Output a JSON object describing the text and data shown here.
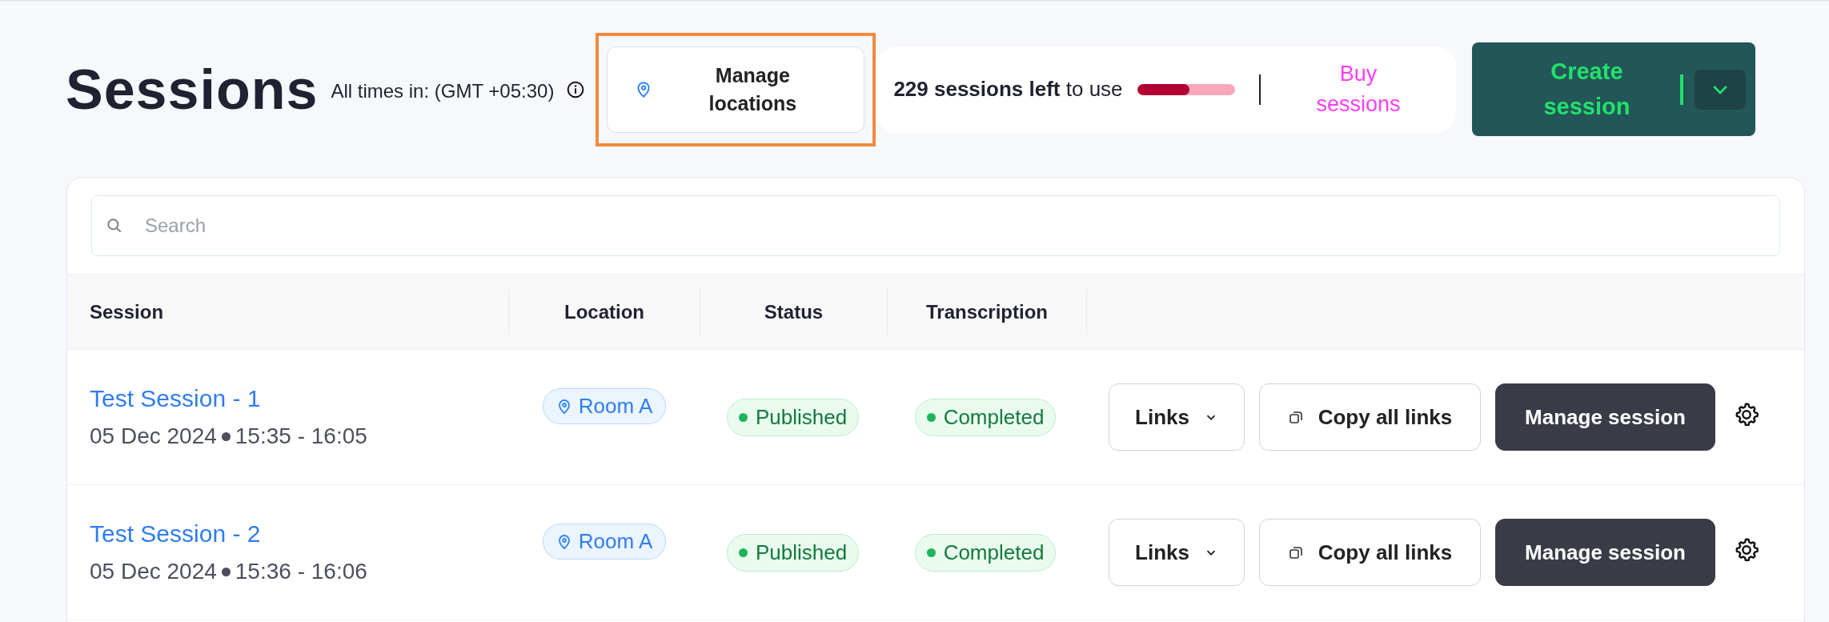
{
  "header": {
    "title": "Sessions",
    "timezone": "All times in: (GMT +05:30)",
    "manage_locations": {
      "label": "Manage locations",
      "highlighted": true
    },
    "usage": {
      "count": "229 sessions left",
      "suffix": "to use",
      "level": 0.54,
      "buy": "Buy sessions"
    },
    "create": {
      "label": "Create session"
    }
  },
  "search": {
    "placeholder": "Search"
  },
  "table": {
    "columns": [
      "Session",
      "Location",
      "Status",
      "Transcription"
    ],
    "rows": [
      {
        "name": "Test Session - 1",
        "date": "05 Dec 2024",
        "time": "15:35 - 16:05",
        "location": "Room A",
        "status": "Published",
        "transcription": "Completed",
        "links": "Links",
        "copy": "Copy all links",
        "manage": "Manage session"
      },
      {
        "name": "Test Session - 2",
        "date": "05 Dec 2024",
        "time": "15:36 - 16:06",
        "location": "Room A",
        "status": "Published",
        "transcription": "Completed",
        "links": "Links",
        "copy": "Copy all links",
        "manage": "Manage session"
      }
    ]
  }
}
